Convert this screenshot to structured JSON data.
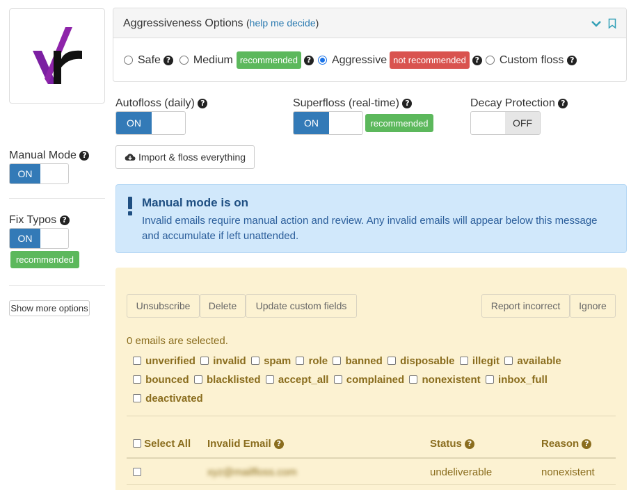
{
  "logo": {
    "text": "vr"
  },
  "left": {
    "manual_mode": {
      "label": "Manual Mode",
      "on": "ON"
    },
    "fix_typos": {
      "label": "Fix Typos",
      "on": "ON",
      "badge": "recommended"
    },
    "show_more": "Show more options"
  },
  "aggressiveness": {
    "title": "Aggressiveness Options",
    "paren_open": "(",
    "help_link": "help me decide",
    "paren_close": ")",
    "options": [
      {
        "label": "Safe",
        "checked": false
      },
      {
        "label": "Medium",
        "checked": false,
        "badge": "recommended"
      },
      {
        "label": "Aggressive",
        "checked": true,
        "badge": "not recommended"
      },
      {
        "label": "Custom floss",
        "checked": false
      }
    ],
    "colors": {
      "accent": "#33a0b7"
    }
  },
  "toggles": {
    "autofloss": {
      "label": "Autofloss (daily)",
      "on": "ON"
    },
    "superfloss": {
      "label": "Superfloss (real-time)",
      "on": "ON",
      "badge": "recommended"
    },
    "decay": {
      "label": "Decay Protection",
      "off": "OFF"
    }
  },
  "import_button": "Import & floss everything",
  "alert": {
    "title": "Manual mode is on",
    "body": "Invalid emails require manual action and review. Any invalid emails will appear below this message and accumulate if left unattended."
  },
  "actions": {
    "unsubscribe": "Unsubscribe",
    "delete": "Delete",
    "update_custom": "Update custom fields",
    "report": "Report incorrect",
    "ignore": "Ignore"
  },
  "selected_text": "0 emails are selected.",
  "filters": {
    "row1": [
      "unverified",
      "invalid",
      "spam",
      "role",
      "banned",
      "disposable",
      "illegit",
      "available"
    ],
    "row2": [
      "bounced",
      "blacklisted",
      "accept_all",
      "complained",
      "nonexistent",
      "inbox_full"
    ],
    "row3": [
      "deactivated"
    ]
  },
  "table": {
    "headers": {
      "select_all": "Select All",
      "email": "Invalid Email",
      "status": "Status",
      "reason": "Reason"
    },
    "rows": [
      {
        "email": "xyz@mailfloss.com",
        "status": "undeliverable",
        "reason": "nonexistent"
      }
    ]
  }
}
